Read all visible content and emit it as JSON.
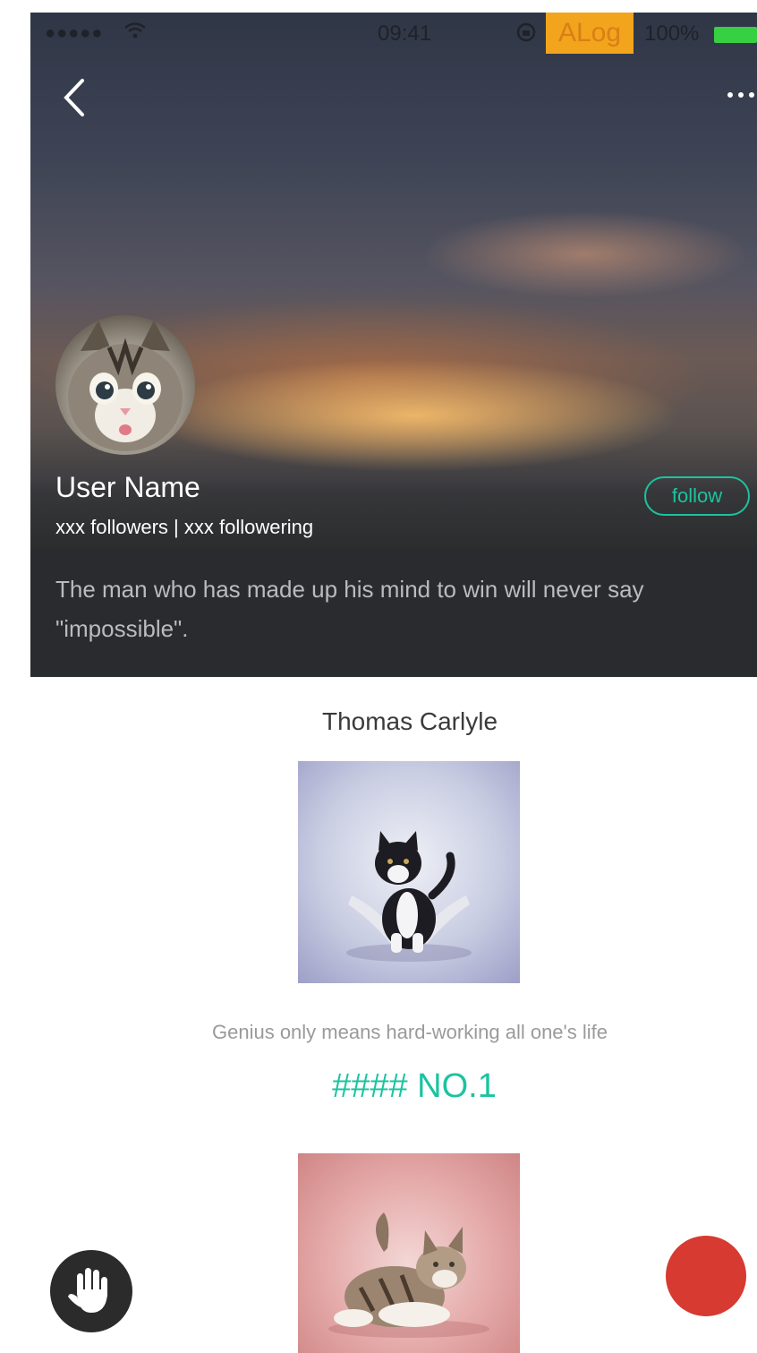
{
  "status_bar": {
    "signal": "●●●●●",
    "wifi_icon": "wifi-icon",
    "time": "09:41",
    "lock_icon": "orientation-lock-icon",
    "alog_label": "ALog",
    "battery_percent": "100%",
    "battery_level": 1.0,
    "battery_color": "#37d043"
  },
  "nav": {
    "back_icon": "chevron-left-icon",
    "back_glyph": "〈",
    "more_icon": "more-horizontal-icon",
    "more_glyph": "···"
  },
  "profile": {
    "user_name": "User Name",
    "follow_stats": "xxx followers | xxx followering",
    "follow_label": "follow",
    "bio": "The man who has made up his mind to win will never say \"impossible\"."
  },
  "content": {
    "author": "Thomas Carlyle",
    "quote": "Genius only means hard-working all one's life",
    "heading": "#### NO.1"
  },
  "fabs": {
    "hand_icon": "hand-icon",
    "red_button": "record-button"
  },
  "colors": {
    "accent": "#1cc3a0",
    "alog_bg": "#f2a41c",
    "fab_red": "#d63a30",
    "fab_dark": "#2b2b2b"
  }
}
